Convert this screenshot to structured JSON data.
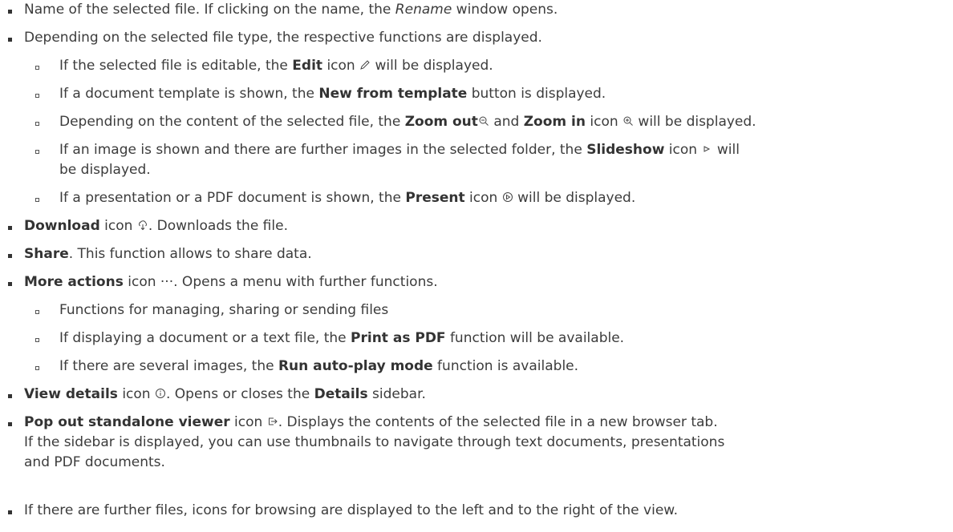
{
  "items": [
    {
      "pre": "Name of the selected file. If clicking on the name, the ",
      "em": "Rename",
      "post": " window opens."
    },
    {
      "text": "Depending on the selected file type, the respective functions are displayed."
    },
    {
      "pre": "If the selected file is editable, the ",
      "bold": "Edit",
      "mid": " icon ",
      "post": " will be displayed."
    },
    {
      "pre": "If a document template is shown, the ",
      "bold": "New from template",
      "post": " button is displayed."
    },
    {
      "pre": "Depending on the content of the selected file, the ",
      "bold1": "Zoom out",
      "mid1": " and ",
      "bold2": "Zoom in",
      "mid2": "  icon ",
      "post": " will be displayed."
    },
    {
      "pre": "If an image is shown and there are further images in the selected folder, the ",
      "bold": "Slideshow",
      "mid": " icon ",
      "post": " will",
      "cont": "be displayed."
    },
    {
      "pre": "If a presentation or a PDF document is shown, the ",
      "bold": "Present",
      "mid": " icon ",
      "post": " will be displayed."
    },
    {
      "bold": "Download",
      "mid": " icon ",
      "post": ". Downloads the file."
    },
    {
      "bold": "Share",
      "post": ". This function allows to share data."
    },
    {
      "bold": "More actions",
      "mid": " icon ",
      "icon": "···",
      "post": ". Opens a menu with further functions."
    },
    {
      "text": "Functions for managing, sharing or sending files"
    },
    {
      "pre": "If displaying a document or a text file, the ",
      "bold": "Print as PDF",
      "post": " function will be available."
    },
    {
      "pre": "If there are several images, the ",
      "bold": "Run auto-play mode",
      "post": " function is available."
    },
    {
      "bold1": "View details",
      "mid1": " icon ",
      "mid2": ". Opens or closes the ",
      "bold2": "Details",
      "post": " sidebar."
    },
    {
      "bold": "Pop out standalone viewer",
      "mid": " icon ",
      "post": ". Displays the contents of the selected file in a new browser tab.",
      "cont1": "If the sidebar is displayed, you can use thumbnails to navigate through text documents, presentations",
      "cont2": "and PDF documents."
    },
    {
      "text": "If there are further files, icons for browsing are displayed to the left and to the right of the view."
    }
  ]
}
